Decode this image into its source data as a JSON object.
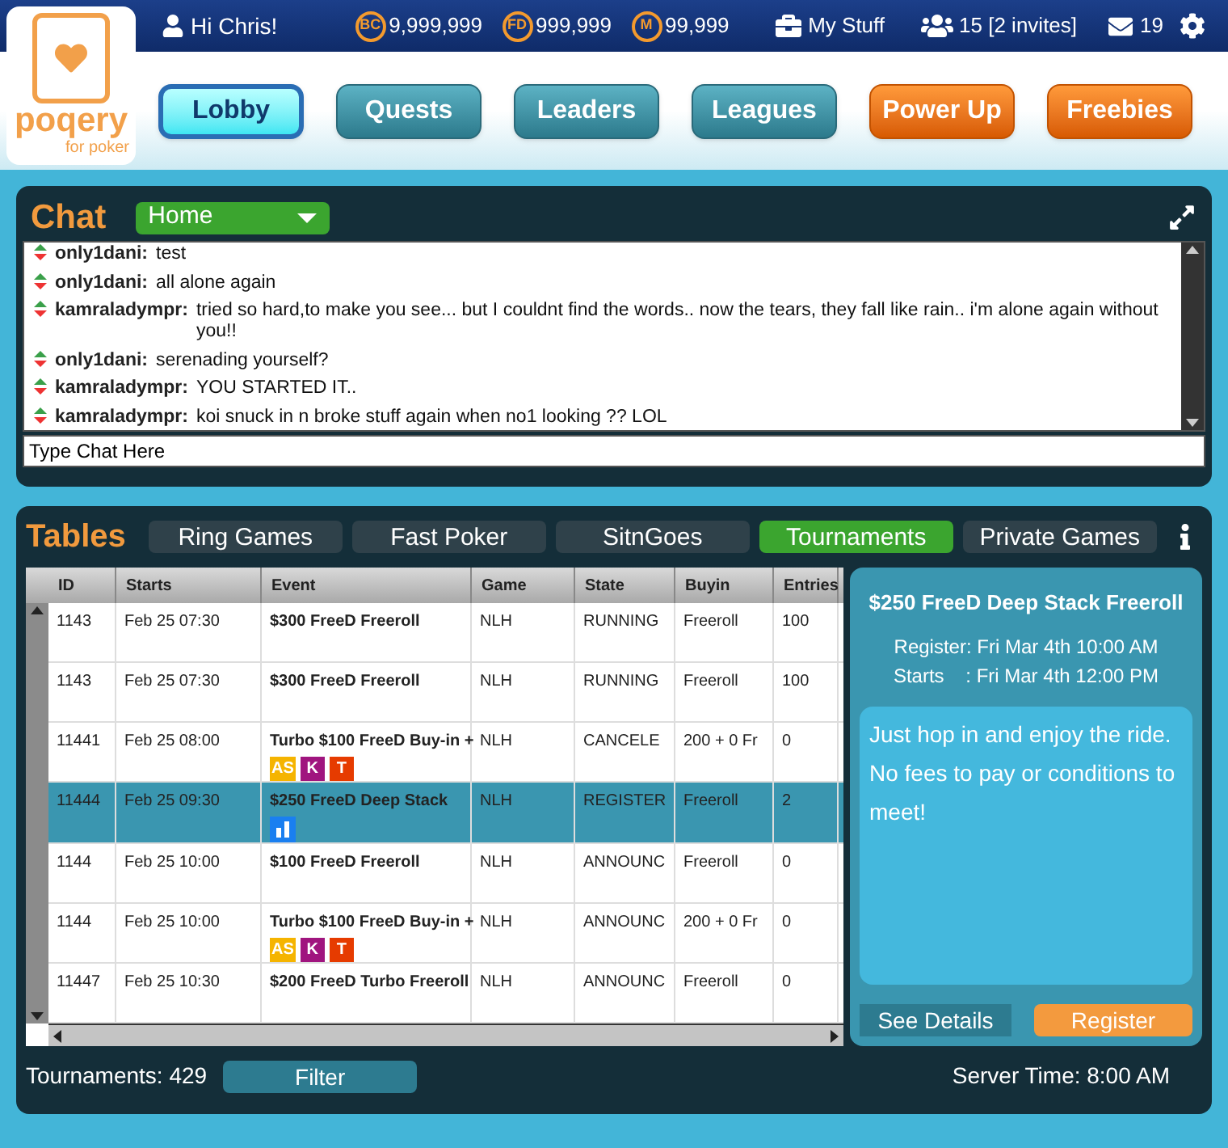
{
  "logo": {
    "name": "poqery",
    "tagline": "for poker"
  },
  "topbar": {
    "greeting": "Hi Chris!",
    "currencies": [
      {
        "code": "BC",
        "amount": "9,999,999"
      },
      {
        "code": "FD",
        "amount": "999,999"
      },
      {
        "code": "M",
        "amount": "99,999"
      }
    ],
    "my_stuff": "My Stuff",
    "friends": "15 [2 invites]",
    "messages": "19"
  },
  "nav": [
    {
      "label": "Lobby",
      "kind": "teal",
      "selected": true
    },
    {
      "label": "Quests",
      "kind": "teal",
      "selected": false
    },
    {
      "label": "Leaders",
      "kind": "teal",
      "selected": false
    },
    {
      "label": "Leagues",
      "kind": "teal",
      "selected": false
    },
    {
      "label": "Power Up",
      "kind": "orange",
      "selected": false
    },
    {
      "label": "Freebies",
      "kind": "orange",
      "selected": false
    }
  ],
  "chat": {
    "title": "Chat",
    "room": "Home",
    "messages": [
      {
        "user": "only1dani:",
        "text": "test"
      },
      {
        "user": "only1dani:",
        "text": "all alone again"
      },
      {
        "user": "kamraladympr:",
        "text": "tried so hard,to make you see... but I couldnt find the words.. now the tears, they fall like rain.. i'm alone again without you!!"
      },
      {
        "user": "only1dani:",
        "text": "serenading yourself?"
      },
      {
        "user": "kamraladympr:",
        "text": "YOU STARTED IT.."
      },
      {
        "user": "kamraladympr:",
        "text": "koi snuck in n broke stuff again when no1 looking ?? LOL"
      }
    ],
    "placeholder": "Type Chat Here"
  },
  "tables": {
    "title": "Tables",
    "tabs": [
      {
        "label": "Ring Games",
        "selected": false
      },
      {
        "label": "Fast Poker",
        "selected": false
      },
      {
        "label": "SitnGoes",
        "selected": false
      },
      {
        "label": "Tournaments",
        "selected": true
      },
      {
        "label": "Private Games",
        "selected": false
      }
    ],
    "columns": [
      "ID",
      "Starts",
      "Event",
      "Game",
      "State",
      "Buyin",
      "Entries"
    ],
    "rows": [
      {
        "cells": [
          "1143",
          "Feb 25 07:30",
          "$300 FreeD Freeroll",
          "NLH",
          "RUNNING",
          "Freeroll",
          "100"
        ],
        "badges": [],
        "selected": false
      },
      {
        "cells": [
          "1143",
          "Feb 25 07:30",
          "$300 FreeD Freeroll",
          "NLH",
          "RUNNING",
          "Freeroll",
          "100"
        ],
        "badges": [],
        "selected": false
      },
      {
        "cells": [
          "11441",
          "Feb 25 08:00",
          "Turbo $100 FreeD Buy-in +",
          "NLH",
          "CANCELE",
          "200 + 0 Fr",
          "0"
        ],
        "badges": [
          {
            "kind": "text",
            "text": "AS",
            "color": "#f5b400"
          },
          {
            "kind": "text",
            "text": "K",
            "color": "#a0157f"
          },
          {
            "kind": "text",
            "text": "T",
            "color": "#e63b00"
          }
        ],
        "selected": false
      },
      {
        "cells": [
          "11444",
          "Feb 25 09:30",
          "$250 FreeD Deep Stack",
          "NLH",
          "REGISTER",
          "Freeroll",
          "2"
        ],
        "badges": [
          {
            "kind": "chart",
            "color": "#1a7ff0"
          }
        ],
        "selected": true
      },
      {
        "cells": [
          "1144",
          "Feb 25 10:00",
          "$100 FreeD Freeroll",
          "NLH",
          "ANNOUNC",
          "Freeroll",
          "0"
        ],
        "badges": [],
        "selected": false
      },
      {
        "cells": [
          "1144",
          "Feb 25 10:00",
          "Turbo $100 FreeD Buy-in +",
          "NLH",
          "ANNOUNC",
          "200 + 0 Fr",
          "0"
        ],
        "badges": [
          {
            "kind": "text",
            "text": "AS",
            "color": "#f5b400"
          },
          {
            "kind": "text",
            "text": "K",
            "color": "#a0157f"
          },
          {
            "kind": "text",
            "text": "T",
            "color": "#e63b00"
          }
        ],
        "selected": false
      },
      {
        "cells": [
          "11447",
          "Feb 25 10:30",
          "$200 FreeD Turbo Freeroll",
          "NLH",
          "ANNOUNC",
          "Freeroll",
          "0"
        ],
        "badges": [],
        "selected": false
      }
    ],
    "detail": {
      "title": "$250 FreeD Deep Stack Freeroll",
      "register": "Register: Fri Mar 4th 10:00 AM",
      "starts": "Starts    : Fri Mar 4th 12:00 PM",
      "description": "Just hop in and enjoy the ride. No fees to pay or conditions to meet!",
      "details_button": "See Details",
      "register_button": "Register"
    },
    "count": "Tournaments: 429",
    "filter": "Filter",
    "server_time": "Server Time: 8:00 AM"
  }
}
